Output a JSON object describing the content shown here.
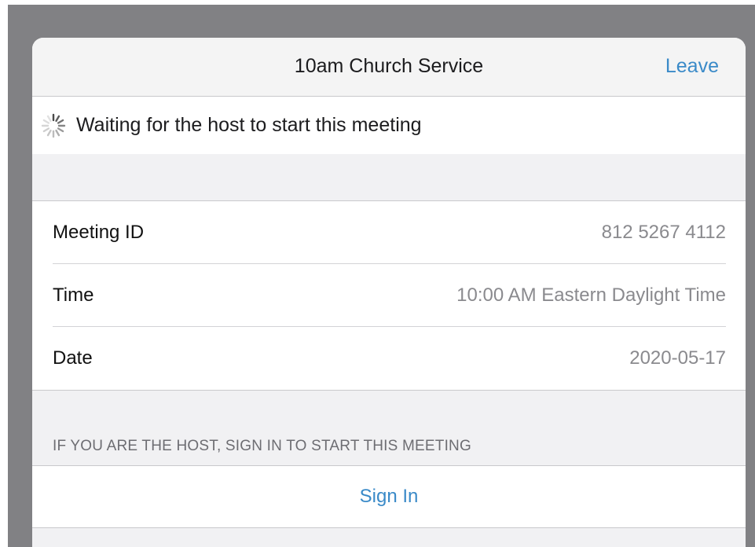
{
  "navbar": {
    "title": "10am Church Service",
    "leave_label": "Leave"
  },
  "status": {
    "icon": "loading-spinner-icon",
    "text": "Waiting for the host to start this meeting"
  },
  "meeting_info": {
    "rows": [
      {
        "label": "Meeting ID",
        "value": "812 5267 4112"
      },
      {
        "label": "Time",
        "value": "10:00 AM Eastern Daylight Time"
      },
      {
        "label": "Date",
        "value": "2020-05-17"
      }
    ]
  },
  "host": {
    "section_header": "IF YOU ARE THE HOST, SIGN IN TO START THIS MEETING",
    "signin_label": "Sign In"
  },
  "colors": {
    "accent": "#3a8ac8",
    "backdrop": "#818184",
    "grouped_background": "#f1f1f3"
  }
}
